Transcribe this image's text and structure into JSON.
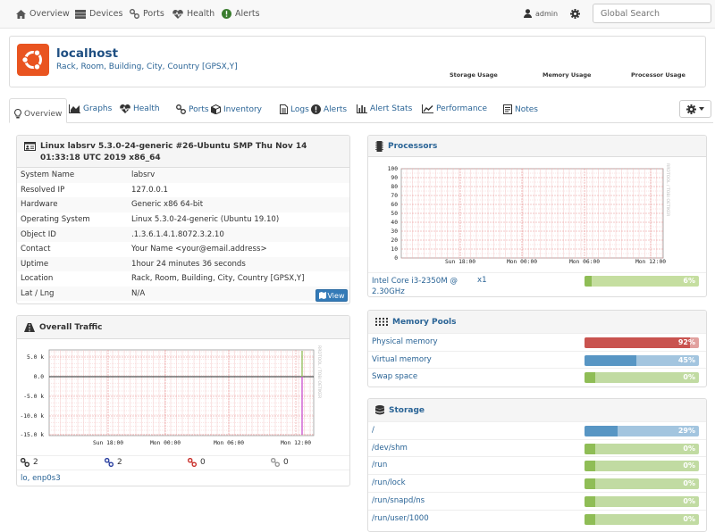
{
  "navbar": {
    "overview": "Overview",
    "devices": "Devices",
    "ports": "Ports",
    "health": "Health",
    "alerts": "Alerts",
    "user": "admin",
    "search_placeholder": "Global Search"
  },
  "device": {
    "hostname": "localhost",
    "location": "Rack, Room, Building, City, Country [GPSX,Y]",
    "storage_usage_label": "Storage Usage",
    "memory_usage_label": "Memory Usage",
    "processor_usage_label": "Processor Usage"
  },
  "tabs": [
    "Overview",
    "Graphs",
    "Health",
    "Ports",
    "Inventory",
    "Logs",
    "Alerts",
    "Alert Stats",
    "Performance",
    "Notes"
  ],
  "overview": {
    "title": "Linux labsrv 5.3.0-24-generic #26-Ubuntu SMP Thu Nov 14 01:33:18 UTC 2019 x86_64",
    "rows": [
      {
        "key": "System Name",
        "value": "labsrv"
      },
      {
        "key": "Resolved IP",
        "value": "127.0.0.1"
      },
      {
        "key": "Hardware",
        "value": "Generic x86 64-bit"
      },
      {
        "key": "Operating System",
        "value": "Linux 5.3.0-24-generic (Ubuntu 19.10)"
      },
      {
        "key": "Object ID",
        "value": ".1.3.6.1.4.1.8072.3.2.10"
      },
      {
        "key": "Contact",
        "value": "Your Name <your@email.address>"
      },
      {
        "key": "Uptime",
        "value": "1hour 24 minutes 36 seconds"
      },
      {
        "key": "Location",
        "value": "Rack, Room, Building, City, Country [GPSX,Y]"
      },
      {
        "key": "Lat / Lng",
        "value": "N/A"
      }
    ],
    "view_button": "View"
  },
  "traffic": {
    "title": "Overall Traffic",
    "y_ticks": [
      "5.0 k",
      "0.0",
      "-5.0 k",
      "-10.0 k",
      "-15.0 k"
    ],
    "x_ticks": [
      "Sun 18:00",
      "Mon 00:00",
      "Mon 06:00",
      "Mon 12:00"
    ],
    "watermark": "RRDTOOL / TOBI OETIKER",
    "counts": [
      "2",
      "2",
      "0",
      "0"
    ],
    "interfaces": "lo, enp0s3"
  },
  "processors": {
    "title": "Processors",
    "y_ticks": [
      "100",
      "90",
      "80",
      "70",
      "60",
      "50",
      "40",
      "30",
      "20",
      "10",
      "0"
    ],
    "x_ticks": [
      "Sun 18:00",
      "Mon 00:00",
      "Mon 06:00",
      "Mon 12:00"
    ],
    "watermark": "RRDTOOL / TOBI OETIKER",
    "cpu_name": "Intel Core i3-2350M @ 2.30GHz",
    "cpu_count": "x1",
    "cpu_usage": "6%"
  },
  "memory": {
    "title": "Memory Pools",
    "pools": [
      {
        "name": "Physical memory",
        "percent_label": "92%",
        "percent": 92,
        "color": "#c9534f"
      },
      {
        "name": "Virtual memory",
        "percent_label": "45%",
        "percent": 45,
        "color": "#5896c4"
      },
      {
        "name": "Swap space",
        "percent_label": "0%",
        "percent": 0,
        "color": "#8fbd56"
      }
    ]
  },
  "storage": {
    "title": "Storage",
    "mounts": [
      {
        "name": "/",
        "percent_label": "29%",
        "percent": 29,
        "color": "#5896c4"
      },
      {
        "name": "/dev/shm",
        "percent_label": "0%",
        "percent": 0,
        "color": "#8fbd56"
      },
      {
        "name": "/run",
        "percent_label": "0%",
        "percent": 0,
        "color": "#8fbd56"
      },
      {
        "name": "/run/lock",
        "percent_label": "0%",
        "percent": 0,
        "color": "#8fbd56"
      },
      {
        "name": "/run/snapd/ns",
        "percent_label": "0%",
        "percent": 0,
        "color": "#8fbd56"
      },
      {
        "name": "/run/user/1000",
        "percent_label": "0%",
        "percent": 0,
        "color": "#8fbd56"
      }
    ]
  },
  "colors": {
    "link": "#2a6496",
    "ubuntu_logo": "#e95420",
    "bar_green": "#8fbd56",
    "bar_red": "#c9534f",
    "bar_blue": "#5896c4"
  }
}
